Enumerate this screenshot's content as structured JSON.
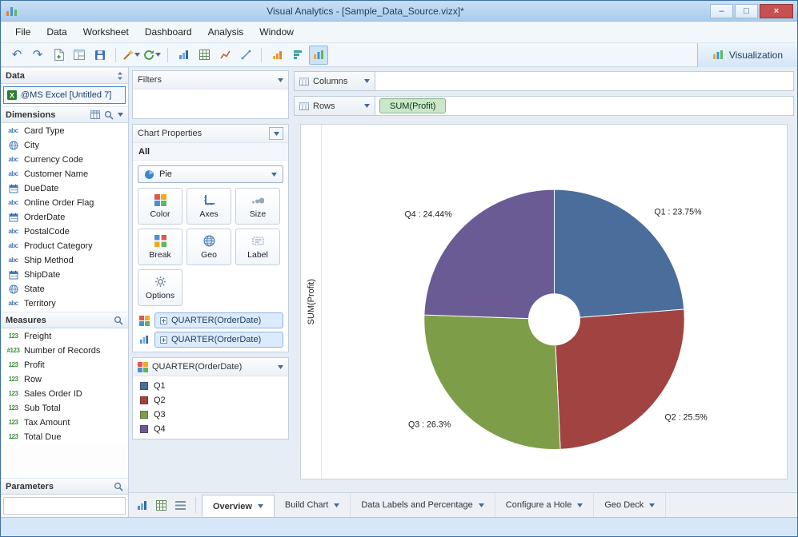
{
  "window": {
    "title": "Visual Analytics - [Sample_Data_Source.vizx]*",
    "minimize_glyph": "–",
    "maximize_glyph": "□",
    "close_glyph": "×"
  },
  "menubar": {
    "items": [
      "File",
      "Data",
      "Worksheet",
      "Dashboard",
      "Analysis",
      "Window"
    ]
  },
  "toolbar": {
    "visualization_label": "Visualization"
  },
  "theme": {
    "close_button": "#c75050",
    "selection": "#cfe3f7",
    "pill_blue_bg": "#dcebfb",
    "pill_green_bg": "#cbe7cb",
    "statusbar_bg": "#d5e7f8"
  },
  "data_panel": {
    "header": "Data",
    "connection": "@MS Excel [Untitled 7]",
    "dimensions": {
      "header": "Dimensions",
      "items": [
        {
          "type": "abc",
          "label": "Card Type"
        },
        {
          "type": "globe",
          "label": "City"
        },
        {
          "type": "abc",
          "label": "Currency Code"
        },
        {
          "type": "abc",
          "label": "Customer Name"
        },
        {
          "type": "calendar",
          "label": "DueDate"
        },
        {
          "type": "abc",
          "label": "Online Order Flag"
        },
        {
          "type": "calendar",
          "label": "OrderDate"
        },
        {
          "type": "abc",
          "label": "PostalCode"
        },
        {
          "type": "abc",
          "label": "Product Category"
        },
        {
          "type": "abc",
          "label": "Ship Method"
        },
        {
          "type": "calendar",
          "label": "ShipDate"
        },
        {
          "type": "globe",
          "label": "State"
        },
        {
          "type": "abc",
          "label": "Territory"
        }
      ]
    },
    "measures": {
      "header": "Measures",
      "items": [
        {
          "type": "num",
          "label": "Freight"
        },
        {
          "type": "numauto",
          "label": "Number of Records"
        },
        {
          "type": "num",
          "label": "Profit"
        },
        {
          "type": "num",
          "label": "Row"
        },
        {
          "type": "num",
          "label": "Sales Order ID"
        },
        {
          "type": "num",
          "label": "Sub Total"
        },
        {
          "type": "num",
          "label": "Tax Amount"
        },
        {
          "type": "num",
          "label": "Total Due"
        }
      ]
    },
    "parameters": {
      "header": "Parameters"
    }
  },
  "filters": {
    "header": "Filters"
  },
  "chart_properties": {
    "header": "Chart Properties",
    "scope": "All",
    "chart_type": "Pie",
    "buttons": [
      {
        "icon": "color",
        "label": "Color"
      },
      {
        "icon": "axes",
        "label": "Axes"
      },
      {
        "icon": "size",
        "label": "Size"
      },
      {
        "icon": "break",
        "label": "Break"
      },
      {
        "icon": "geo",
        "label": "Geo"
      },
      {
        "icon": "label",
        "label": "Label"
      },
      {
        "icon": "options",
        "label": "Options"
      }
    ],
    "shelves": [
      {
        "icon": "colorgrid",
        "pill": "QUARTER(OrderDate)"
      },
      {
        "icon": "barchart",
        "pill": "QUARTER(OrderDate)"
      }
    ]
  },
  "legend": {
    "header": "QUARTER(OrderDate)"
  },
  "shelf_bar": {
    "columns_label": "Columns",
    "rows_label": "Rows",
    "rows_pills": [
      "SUM(Profit)"
    ]
  },
  "chart_data": {
    "type": "pie",
    "categories": [
      "Q1",
      "Q2",
      "Q3",
      "Q4"
    ],
    "values": [
      23.75,
      25.5,
      26.3,
      24.44
    ],
    "labels": [
      "Q1 : 23.75%",
      "Q2 : 25.5%",
      "Q3 : 26.3%",
      "Q4 : 24.44%"
    ],
    "colors": [
      "#4a6d9c",
      "#a04341",
      "#7e9d49",
      "#6a5b95"
    ],
    "ylabel": "SUM(Profit)",
    "donut": true,
    "hole_ratio": 0.2,
    "start_angle_deg": 0,
    "direction": "clockwise",
    "legend_position": "side-panel"
  },
  "sheet_tabs": [
    {
      "label": "Overview",
      "active": true
    },
    {
      "label": "Build Chart",
      "active": false
    },
    {
      "label": "Data Labels and Percentage",
      "active": false
    },
    {
      "label": "Configure a Hole",
      "active": false
    },
    {
      "label": "Geo Deck",
      "active": false
    }
  ]
}
